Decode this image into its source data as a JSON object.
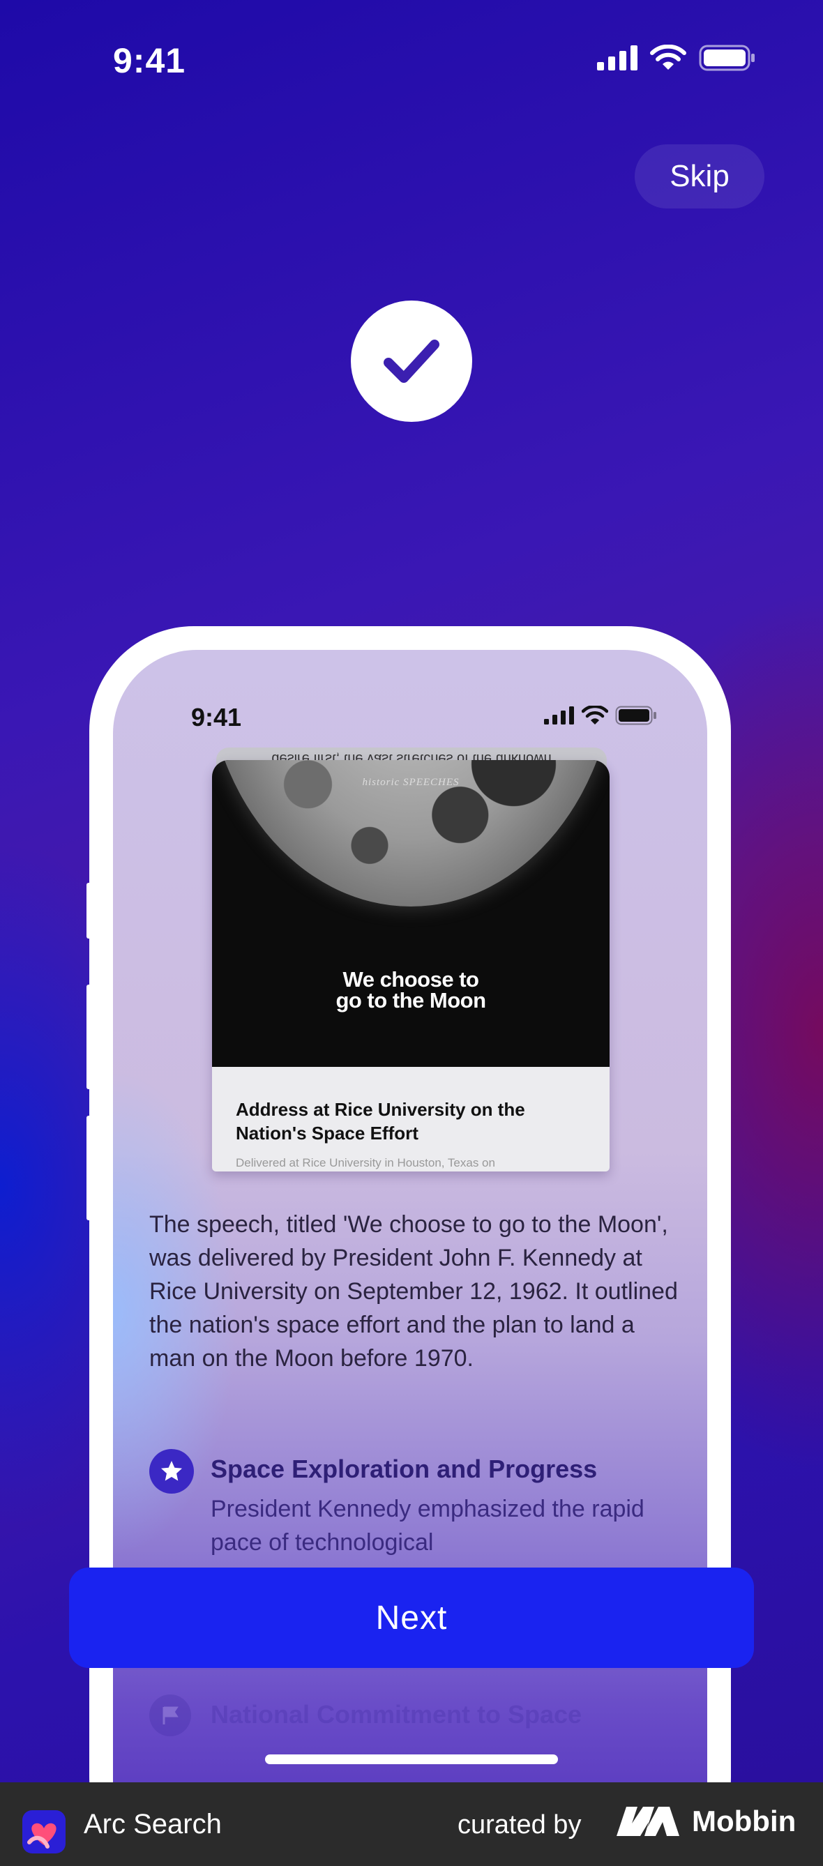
{
  "status_bar": {
    "time": "9:41"
  },
  "header": {
    "skip_label": "Skip"
  },
  "phone": {
    "time": "9:41",
    "card": {
      "back_peek_text": "desire first, the vast stretches of the unknown",
      "brand": "historic SPEECHES",
      "headline_line1": "We choose to",
      "headline_line2": "go to the Moon",
      "title": "Address at Rice University on the Nation's Space Effort",
      "subtitle": "Delivered at Rice University in Houston, Texas on"
    },
    "summary": "The speech, titled 'We choose to go to the Moon', was delivered by President John F. Kennedy at Rice University on September 12, 1962. It outlined the nation's space effort and the plan to land a man on the Moon before 1970.",
    "features": [
      {
        "icon": "star-icon",
        "title": "Space Exploration and Progress",
        "description": "President Kennedy emphasized the rapid pace of technological"
      },
      {
        "icon": "flag-icon",
        "title": "National Commitment to Space"
      }
    ]
  },
  "actions": {
    "next_label": "Next"
  },
  "footer": {
    "app_name": "Arc Search",
    "curated_by": "curated by",
    "brand": "Mobbin"
  },
  "colors": {
    "accent": "#1a23f0",
    "check_fg": "#3b1fb0",
    "feature_icon_bg": "#3b28c4"
  }
}
